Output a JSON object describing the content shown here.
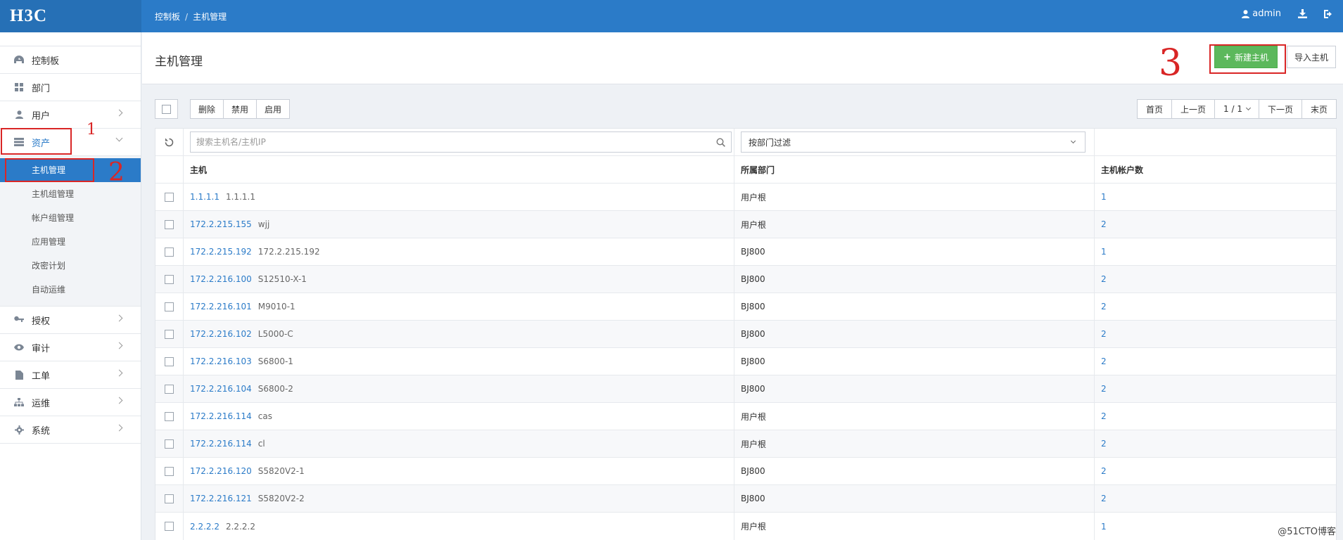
{
  "header": {
    "logo": "H3C",
    "breadcrumb": [
      "控制板",
      "主机管理"
    ],
    "user": "admin",
    "download_icon": "download-icon",
    "logout_icon": "logout-icon"
  },
  "sidebar": {
    "items": [
      {
        "label": "控制板",
        "icon": "dashboard-icon"
      },
      {
        "label": "部门",
        "icon": "grid-icon"
      },
      {
        "label": "用户",
        "icon": "user-icon"
      },
      {
        "label": "资产",
        "icon": "server-icon"
      },
      {
        "label": "授权",
        "icon": "key-icon"
      },
      {
        "label": "审计",
        "icon": "eye-icon"
      },
      {
        "label": "工单",
        "icon": "document-icon"
      },
      {
        "label": "运维",
        "icon": "sitemap-icon"
      },
      {
        "label": "系统",
        "icon": "gear-icon"
      }
    ],
    "asset_sub": [
      "主机管理",
      "主机组管理",
      "帐户组管理",
      "应用管理",
      "改密计划",
      "自动运维"
    ]
  },
  "page": {
    "title": "主机管理",
    "new_host": "新建主机",
    "import_host": "导入主机"
  },
  "toolbar": {
    "actions": [
      "删除",
      "禁用",
      "启用"
    ],
    "pager": {
      "first": "首页",
      "prev": "上一页",
      "current": "1 / 1",
      "next": "下一页",
      "last": "末页"
    }
  },
  "filters": {
    "search_placeholder": "搜索主机名/主机IP",
    "dept_filter": "按部门过滤"
  },
  "table": {
    "columns": [
      "主机",
      "所属部门",
      "主机帐户数"
    ],
    "rows": [
      {
        "ip": "1.1.1.1",
        "name": "1.1.1.1",
        "dept": "用户根",
        "count": "1"
      },
      {
        "ip": "172.2.215.155",
        "name": "wjj",
        "dept": "用户根",
        "count": "2"
      },
      {
        "ip": "172.2.215.192",
        "name": "172.2.215.192",
        "dept": "BJ800",
        "count": "1"
      },
      {
        "ip": "172.2.216.100",
        "name": "S12510-X-1",
        "dept": "BJ800",
        "count": "2"
      },
      {
        "ip": "172.2.216.101",
        "name": "M9010-1",
        "dept": "BJ800",
        "count": "2"
      },
      {
        "ip": "172.2.216.102",
        "name": "L5000-C",
        "dept": "BJ800",
        "count": "2"
      },
      {
        "ip": "172.2.216.103",
        "name": "S6800-1",
        "dept": "BJ800",
        "count": "2"
      },
      {
        "ip": "172.2.216.104",
        "name": "S6800-2",
        "dept": "BJ800",
        "count": "2"
      },
      {
        "ip": "172.2.216.114",
        "name": "cas",
        "dept": "用户根",
        "count": "2"
      },
      {
        "ip": "172.2.216.114",
        "name": "cl",
        "dept": "用户根",
        "count": "2"
      },
      {
        "ip": "172.2.216.120",
        "name": "S5820V2-1",
        "dept": "BJ800",
        "count": "2"
      },
      {
        "ip": "172.2.216.121",
        "name": "S5820V2-2",
        "dept": "BJ800",
        "count": "2"
      },
      {
        "ip": "2.2.2.2",
        "name": "2.2.2.2",
        "dept": "用户根",
        "count": "1"
      }
    ]
  },
  "annotations": [
    "1",
    "2",
    "3"
  ],
  "watermark": "@51CTO博客",
  "colors": {
    "brand": "#2b7bc8",
    "success": "#5cb85c",
    "annotation": "#d92626"
  }
}
